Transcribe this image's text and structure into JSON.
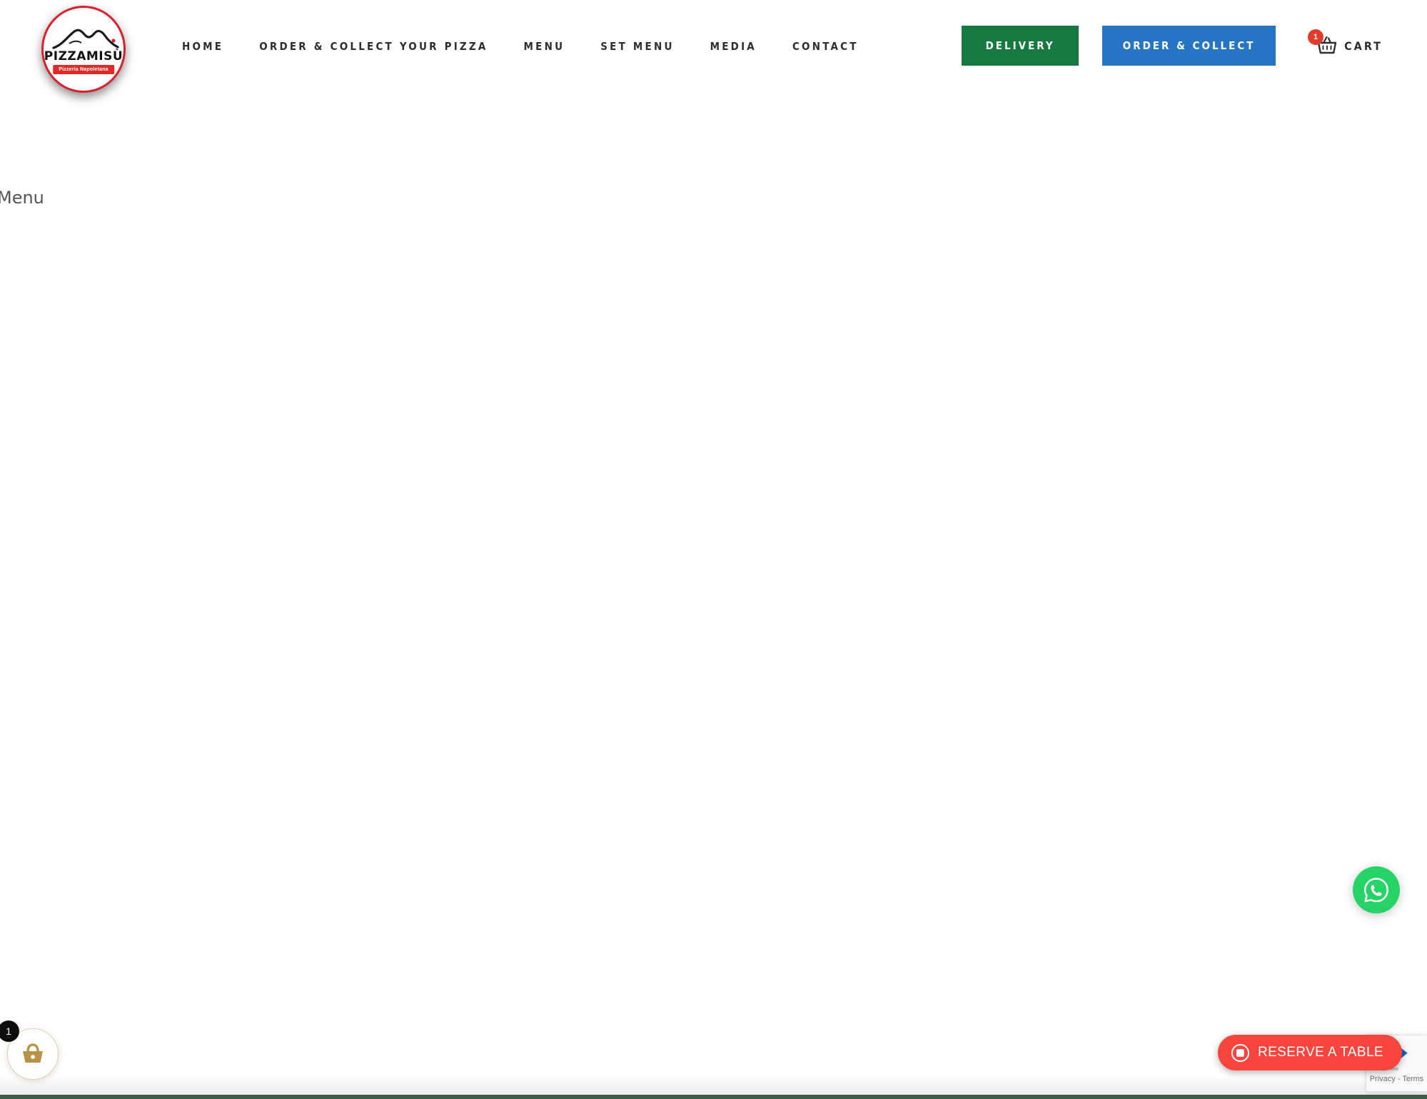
{
  "site": {
    "logo": {
      "name": "PIZZAMISÙ",
      "tagline": "Pizzeria Napoletana",
      "alt": "Pizzamisu Pizzeria Napoletana logo"
    }
  },
  "nav": {
    "items": [
      {
        "label": "HOME"
      },
      {
        "label": "ORDER & COLLECT YOUR PIZZA"
      },
      {
        "label": "MENU"
      },
      {
        "label": "SET MENU"
      },
      {
        "label": "MEDIA"
      },
      {
        "label": "CONTACT"
      }
    ]
  },
  "header_actions": {
    "delivery_label": "DELIVERY",
    "collect_label": "ORDER & COLLECT",
    "cart_label": "CART",
    "cart_count": "1",
    "delivery_color": "#157A3F",
    "collect_color": "#2575C4",
    "cart_badge_color": "#e03b2b"
  },
  "main": {
    "heading": "Menu"
  },
  "floating": {
    "cart_count": "1",
    "cart_badge_color": "#0d0d0d",
    "cart_icon_color": "#b79248",
    "whatsapp_color": "#25D366",
    "reserve_label": "RESERVE A TABLE",
    "reserve_color": "#F8463F"
  },
  "recaptcha": {
    "terms": "Privacy - Terms"
  }
}
